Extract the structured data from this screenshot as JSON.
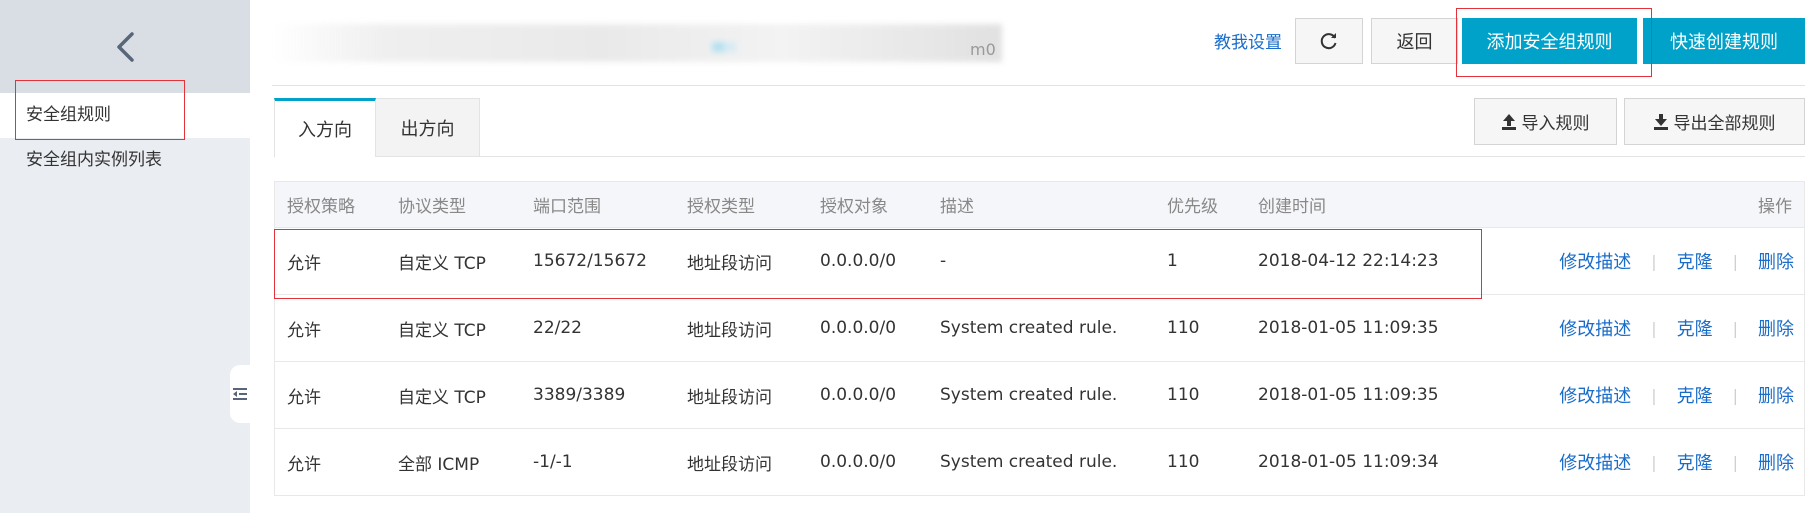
{
  "sidebar": {
    "back_icon": "chevron-left-icon",
    "items": [
      {
        "label": "安全组规则",
        "active": true
      },
      {
        "label": "安全组内实例列表",
        "active": false
      }
    ],
    "collapse_icon": "collapse-icon"
  },
  "header": {
    "title_suffix": "m0",
    "help_link": "教我设置",
    "refresh_icon": "refresh-icon",
    "back_button": "返回",
    "add_rule_button": "添加安全组规则",
    "quick_create_button": "快速创建规则"
  },
  "tabs": [
    {
      "label": "入方向",
      "active": true
    },
    {
      "label": "出方向",
      "active": false
    }
  ],
  "actions": {
    "import": "导入规则",
    "export": "导出全部规则"
  },
  "table": {
    "headers": [
      "授权策略",
      "协议类型",
      "端口范围",
      "授权类型",
      "授权对象",
      "描述",
      "优先级",
      "创建时间",
      "操作"
    ],
    "rows": [
      {
        "policy": "允许",
        "protocol": "自定义 TCP",
        "port": "15672/15672",
        "auth_type": "地址段访问",
        "target": "0.0.0.0/0",
        "desc": "-",
        "priority": "1",
        "time": "2018-04-12 22:14:23"
      },
      {
        "policy": "允许",
        "protocol": "自定义 TCP",
        "port": "22/22",
        "auth_type": "地址段访问",
        "target": "0.0.0.0/0",
        "desc": "System created rule.",
        "priority": "110",
        "time": "2018-01-05 11:09:35"
      },
      {
        "policy": "允许",
        "protocol": "自定义 TCP",
        "port": "3389/3389",
        "auth_type": "地址段访问",
        "target": "0.0.0.0/0",
        "desc": "System created rule.",
        "priority": "110",
        "time": "2018-01-05 11:09:35"
      },
      {
        "policy": "允许",
        "protocol": "全部 ICMP",
        "port": "-1/-1",
        "auth_type": "地址段访问",
        "target": "0.0.0.0/0",
        "desc": "System created rule.",
        "priority": "110",
        "time": "2018-01-05 11:09:34"
      }
    ],
    "op_edit": "修改描述",
    "op_clone": "克隆",
    "op_delete": "删除",
    "op_sep": "|"
  },
  "colors": {
    "primary": "#00a2ca",
    "link": "#1a6cc9",
    "highlight_box": "#e3323a"
  }
}
